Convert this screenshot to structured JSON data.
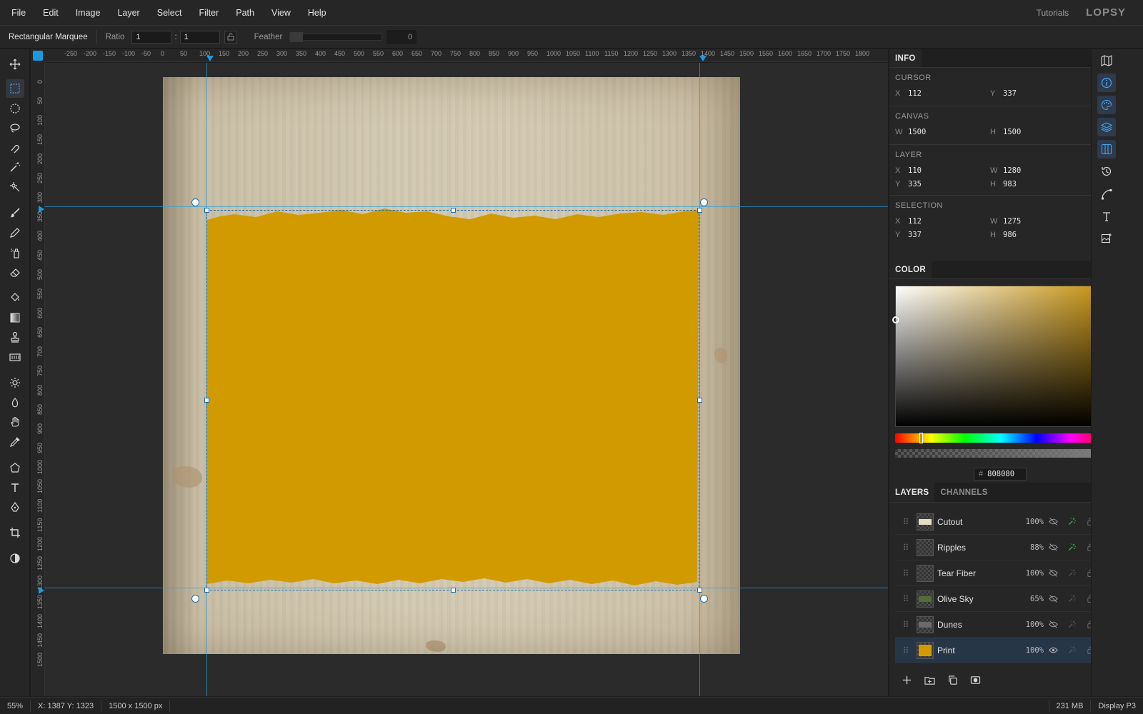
{
  "menu": {
    "items": [
      "File",
      "Edit",
      "Image",
      "Layer",
      "Select",
      "Filter",
      "Path",
      "View",
      "Help"
    ],
    "tutorials": "Tutorials",
    "logo": "LOPSY"
  },
  "options": {
    "tool_name": "Rectangular Marquee",
    "ratio_label": "Ratio",
    "ratio_w": "1",
    "ratio_sep": ":",
    "ratio_h": "1",
    "feather_label": "Feather",
    "feather_value": "0"
  },
  "tools": [
    "move-icon",
    "rect-marquee-icon",
    "ellipse-marquee-icon",
    "lasso-icon",
    "magnetic-lasso-icon",
    "magic-wand-icon",
    "quick-select-icon",
    "brush-icon",
    "pencil-icon",
    "spray-icon",
    "eraser-icon",
    "paint-bucket-icon",
    "gradient-icon",
    "stamp-icon",
    "pattern-icon",
    "dodge-icon",
    "burn-icon",
    "hand-icon",
    "eyedropper-icon",
    "polygon-icon",
    "text-icon",
    "pen-icon",
    "crop-icon",
    "contrast-icon"
  ],
  "ruler": {
    "top_labels": [
      "-250",
      "-200",
      "-150",
      "-100",
      "-50",
      "0",
      "50",
      "100",
      "150",
      "200",
      "250",
      "300",
      "350",
      "400",
      "450",
      "500",
      "550",
      "600",
      "650",
      "700",
      "750",
      "800",
      "850",
      "900",
      "950",
      "1000",
      "1050",
      "1100",
      "1150",
      "1200",
      "1250",
      "1300",
      "1350",
      "1400",
      "1450",
      "1500",
      "1550",
      "1600",
      "1650",
      "1700",
      "1750",
      "1800"
    ],
    "left_labels": [
      "0",
      "50",
      "100",
      "150",
      "200",
      "250",
      "300",
      "350",
      "400",
      "450",
      "500",
      "550",
      "600",
      "650",
      "700",
      "750",
      "800",
      "850",
      "900",
      "950",
      "1000",
      "1050",
      "1100",
      "1150",
      "1200",
      "1250",
      "1300",
      "1350",
      "1400",
      "1450",
      "1500"
    ]
  },
  "info": {
    "tab": "INFO",
    "cursor": {
      "title": "CURSOR",
      "x_label": "X",
      "x": "112",
      "y_label": "Y",
      "y": "337"
    },
    "canvas": {
      "title": "CANVAS",
      "w_label": "W",
      "w": "1500",
      "h_label": "H",
      "h": "1500"
    },
    "layer": {
      "title": "LAYER",
      "x_label": "X",
      "x": "110",
      "w_label": "W",
      "w": "1280",
      "y_label": "Y",
      "y": "335",
      "h_label": "H",
      "h": "983"
    },
    "selection": {
      "title": "SELECTION",
      "x_label": "X",
      "x": "112",
      "w_label": "W",
      "w": "1275",
      "y_label": "Y",
      "y": "337",
      "h_label": "H",
      "h": "986"
    }
  },
  "color": {
    "tab": "COLOR",
    "hash": "#",
    "hex": "808080",
    "picker_hue_color": "#c4900d"
  },
  "layers": {
    "tab_layers": "LAYERS",
    "tab_channels": "CHANNELS",
    "items": [
      {
        "name": "Cutout",
        "opacity": "100%",
        "visible": false,
        "linked": true,
        "selected": false
      },
      {
        "name": "Ripples",
        "opacity": "88%",
        "visible": false,
        "linked": true,
        "selected": false
      },
      {
        "name": "Tear Fiber",
        "opacity": "100%",
        "visible": false,
        "linked": false,
        "selected": false
      },
      {
        "name": "Olive Sky",
        "opacity": "65%",
        "visible": false,
        "linked": false,
        "selected": false
      },
      {
        "name": "Dunes",
        "opacity": "100%",
        "visible": false,
        "linked": false,
        "selected": false
      },
      {
        "name": "Print",
        "opacity": "100%",
        "visible": true,
        "linked": false,
        "selected": true
      }
    ]
  },
  "canvas": {
    "paper_color": "#d2c8b0",
    "print_color": "#d19b00",
    "guide_color": "#28a0dc"
  },
  "status": {
    "zoom": "55%",
    "coords": "X: 1387 Y: 1323",
    "doc_size": "1500 x 1500 px",
    "memory": "231 MB",
    "color_profile": "Display P3"
  }
}
